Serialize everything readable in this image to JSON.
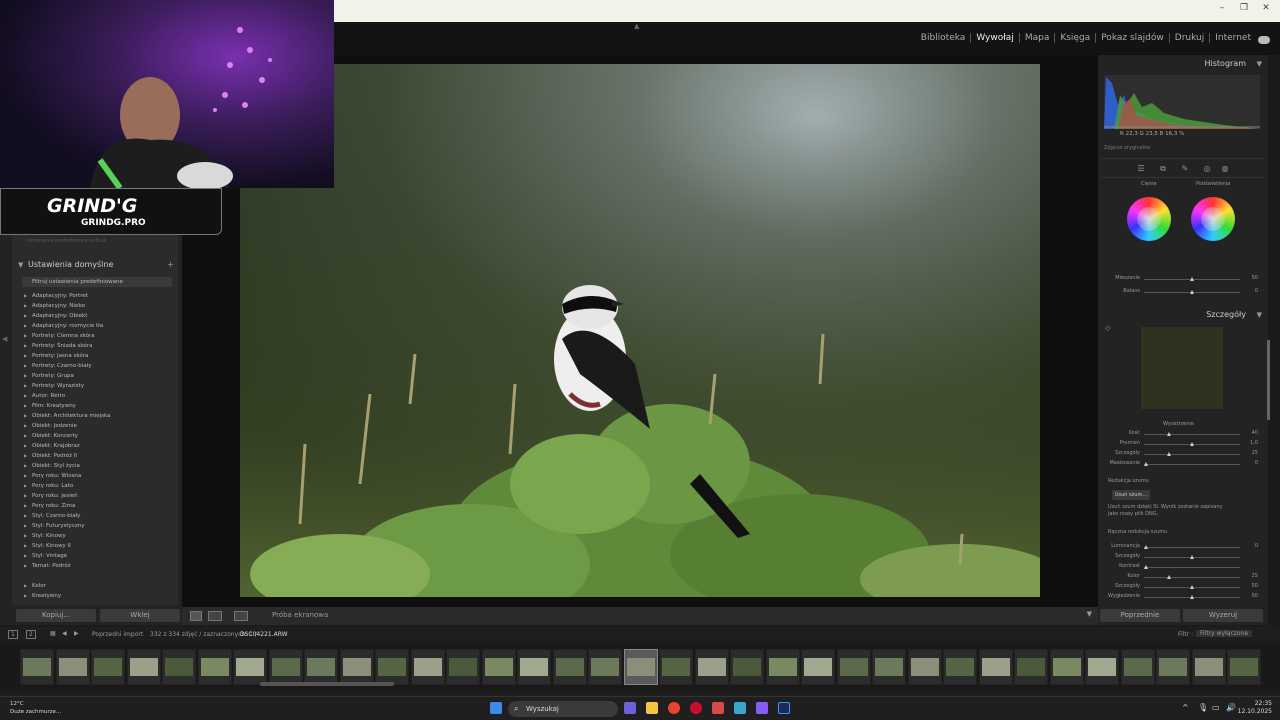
{
  "window": {
    "minimize": "–",
    "maximize": "❐",
    "close": "✕"
  },
  "modules": [
    "Biblioteka",
    "Wywołaj",
    "Mapa",
    "Księga",
    "Pokaz slajdów",
    "Drukuj",
    "Internet"
  ],
  "active_module": "Wywołaj",
  "overlay": {
    "brand": "GRIND'G",
    "url": "GRINDG.PRO"
  },
  "left_panel": {
    "faded_row": "Ustawienia predefiniowane   Brak",
    "presets_header": "Ustawienia domyślne",
    "presets": [
      "Filtruj ustawienia predefiniowane",
      "Adaptacyjny: Portret",
      "Adaptacyjny: Niebo",
      "Adaptacyjny: Obiekt",
      "Adaptacyjny: rozmycie tła",
      "Portrety: Ciemna skóra",
      "Portrety: Śniada skóra",
      "Portrety: Jasna skóra",
      "Portrety: Czarno-biały",
      "Portrety: Grupa",
      "Portrety: Wyrazisty",
      "Autor: Retro",
      "Film: Kreatywny",
      "Obiekt: Architektura miejska",
      "Obiekt: Jedzenie",
      "Obiekt: Koncerty",
      "Obiekt: Krajobraz",
      "Obiekt: Podróż II",
      "Obiekt: Styl życia",
      "Pory roku: Wiosna",
      "Pory roku: Lato",
      "Pory roku: Jesień",
      "Pory roku: Zima",
      "Styl: Czarno-biały",
      "Styl: Futurystyczny",
      "Styl: Kinowy",
      "Styl: Kinowy II",
      "Styl: Vintage",
      "Temat: Podróż",
      "",
      "Kolor",
      "Kreatywny"
    ],
    "copy_button": "Kopiuj...",
    "paste_button": "Wklej"
  },
  "toolbar": {
    "label": "Próba ekranowa"
  },
  "right_panel": {
    "histogram_title": "Histogram",
    "hist_values": "R  22,3  G  23,5  B  16,3  %",
    "original_photo": "Zdjęcie oryginalne",
    "shadows_label": "Cienie",
    "highlights_label": "Podświetlenia",
    "blend_label": "Mieszanie",
    "blend_value": "50",
    "balance_label": "Balans",
    "balance_value": "0",
    "details_title": "Szczegóły",
    "sharpening_label": "Wyostrzenie",
    "sharpening": [
      {
        "label": "Ilość",
        "value": "40",
        "pos": 0.25
      },
      {
        "label": "Promień",
        "value": "1,0",
        "pos": 0.5
      },
      {
        "label": "Szczegóły",
        "value": "25",
        "pos": 0.25
      },
      {
        "label": "Maskowanie",
        "value": "0",
        "pos": 0.0
      }
    ],
    "noise_label": "Redukcja szumu",
    "noise_button": "Usuń szum...",
    "noise_text": "Usuń szum dzięki SI. Wynik zostanie zapisany jako nowy plik DNG.",
    "manual_noise_label": "Ręczna redukcja szumu",
    "manual_noise": [
      {
        "label": "Luminancja",
        "value": "0",
        "pos": 0.0
      },
      {
        "label": "Szczegóły",
        "value": "",
        "pos": 0.5
      },
      {
        "label": "Kontrast",
        "value": "",
        "pos": 0.0
      },
      {
        "label": "Kolor",
        "value": "25",
        "pos": 0.25
      },
      {
        "label": "Szczegóły",
        "value": "50",
        "pos": 0.5
      },
      {
        "label": "Wygładzenie",
        "value": "50",
        "pos": 0.5
      }
    ],
    "previous_button": "Poprzednie",
    "reset_button": "Wyzeruj"
  },
  "filmstrip_bar": {
    "page1": "1",
    "page2": "2",
    "import": "Poprzedni import",
    "count": "332 z 334 zdjęć / zaznaczonych: 1 /",
    "filename": "DSC04221.ARW",
    "filter_label": "Filtr :",
    "filter_value": "Filtry wyłączone"
  },
  "filmstrip": {
    "thumbnails": 35,
    "selected_index": 17
  },
  "taskbar": {
    "weather_temp": "12°C",
    "weather_desc": "Duże zachmurze...",
    "search": "Wyszukaj",
    "time": "22:35",
    "date": "12.10.2025"
  },
  "colors": {
    "accent": "#4a8cff"
  }
}
